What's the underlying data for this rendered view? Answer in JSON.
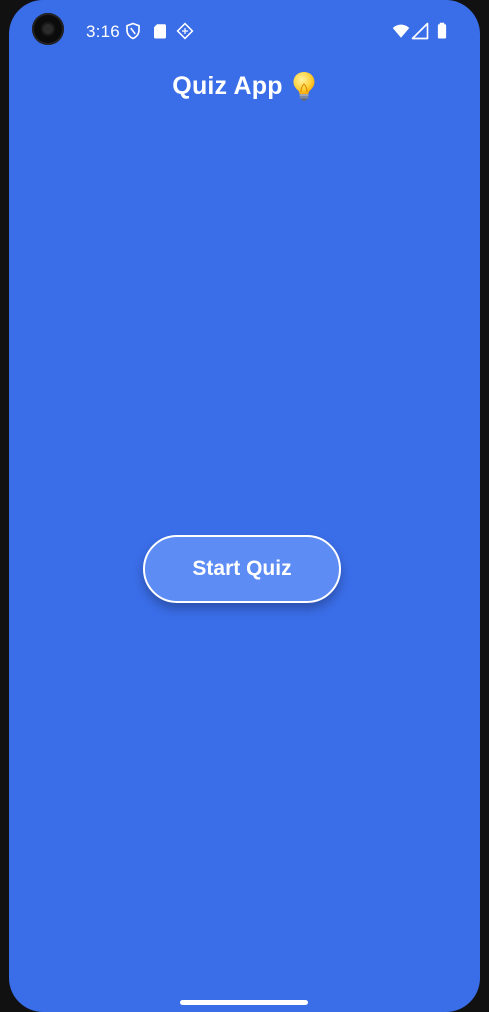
{
  "status_bar": {
    "time": "3:16",
    "icons": [
      "shield-icon",
      "sd-card-icon",
      "diamond-app-icon",
      "wifi-icon",
      "signal-icon",
      "battery-icon"
    ]
  },
  "app": {
    "title": "Quiz App",
    "title_icon": "lightbulb-icon",
    "background_color": "#3A6DE8",
    "start_button_label": "Start Quiz",
    "start_button_color": "#5E8CF5"
  }
}
